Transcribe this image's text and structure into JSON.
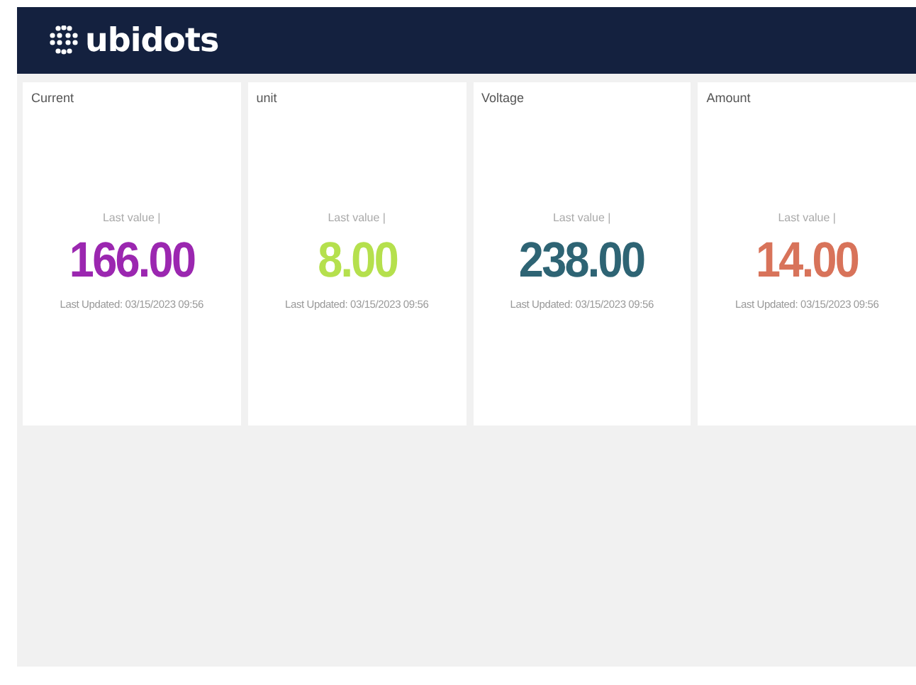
{
  "header": {
    "logo_text": "ubidots"
  },
  "widgets": [
    {
      "title": "Current",
      "caption": "Last value |",
      "value": "166.00",
      "color": "#9b27b0",
      "updated": "Last Updated: 03/15/2023 09:56"
    },
    {
      "title": "unit",
      "caption": "Last value |",
      "value": "8.00",
      "color": "#b5e04d",
      "updated": "Last Updated: 03/15/2023 09:56"
    },
    {
      "title": "Voltage",
      "caption": "Last value |",
      "value": "238.00",
      "color": "#2e6474",
      "updated": "Last Updated: 03/15/2023 09:56"
    },
    {
      "title": "Amount",
      "caption": "Last value |",
      "value": "14.00",
      "color": "#d8735a",
      "updated": "Last Updated: 03/15/2023 09:56"
    }
  ]
}
